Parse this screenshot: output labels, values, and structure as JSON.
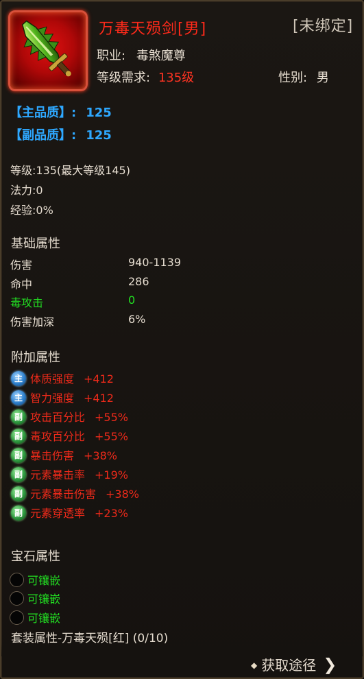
{
  "item": {
    "name": "万毒天殒剑[男]",
    "bind_state": "[未绑定]",
    "job_label": "职业:",
    "job_value": "毒煞魔尊",
    "level_req_label": "等级需求:",
    "level_req_value": "135级",
    "gender_label": "性别:",
    "gender_value": "男",
    "icon": "sword-icon"
  },
  "quality": {
    "main_label": "【主品质】:",
    "main_value": "125",
    "sub_label": "【副品质】:",
    "sub_value": "125"
  },
  "stats": {
    "level": "等级:135(最大等级145)",
    "mana": "法力:0",
    "exp": "经验:0%"
  },
  "base": {
    "title": "基础属性",
    "rows": [
      {
        "label": "伤害",
        "value": "940-1139"
      },
      {
        "label": "命中",
        "value": "286"
      },
      {
        "label": "毒攻击",
        "value": "0"
      },
      {
        "label": "伤害加深",
        "value": "6%"
      }
    ]
  },
  "extra": {
    "title": "附加属性",
    "rows": [
      {
        "badge": "主",
        "label": "体质强度",
        "value": "+412"
      },
      {
        "badge": "主",
        "label": "智力强度",
        "value": "+412"
      },
      {
        "badge": "副",
        "label": "攻击百分比",
        "value": "+55%"
      },
      {
        "badge": "副",
        "label": "毒攻百分比",
        "value": "+55%"
      },
      {
        "badge": "副",
        "label": "暴击伤害",
        "value": "+38%"
      },
      {
        "badge": "副",
        "label": "元素暴击率",
        "value": "+19%"
      },
      {
        "badge": "副",
        "label": "元素暴击伤害",
        "value": "+38%"
      },
      {
        "badge": "副",
        "label": "元素穿透率",
        "value": "+23%"
      }
    ]
  },
  "gems": {
    "title": "宝石属性",
    "slots": [
      "可镶嵌",
      "可镶嵌",
      "可镶嵌"
    ]
  },
  "set": {
    "label": "套装属性-万毒天殒[红] (0/10)"
  },
  "footer": {
    "obtain_label": "获取途径"
  },
  "colors": {
    "name_red": "#ff2a1a",
    "quality_blue": "#2ea8ff",
    "green": "#22e022",
    "text": "#e6ddd0"
  }
}
